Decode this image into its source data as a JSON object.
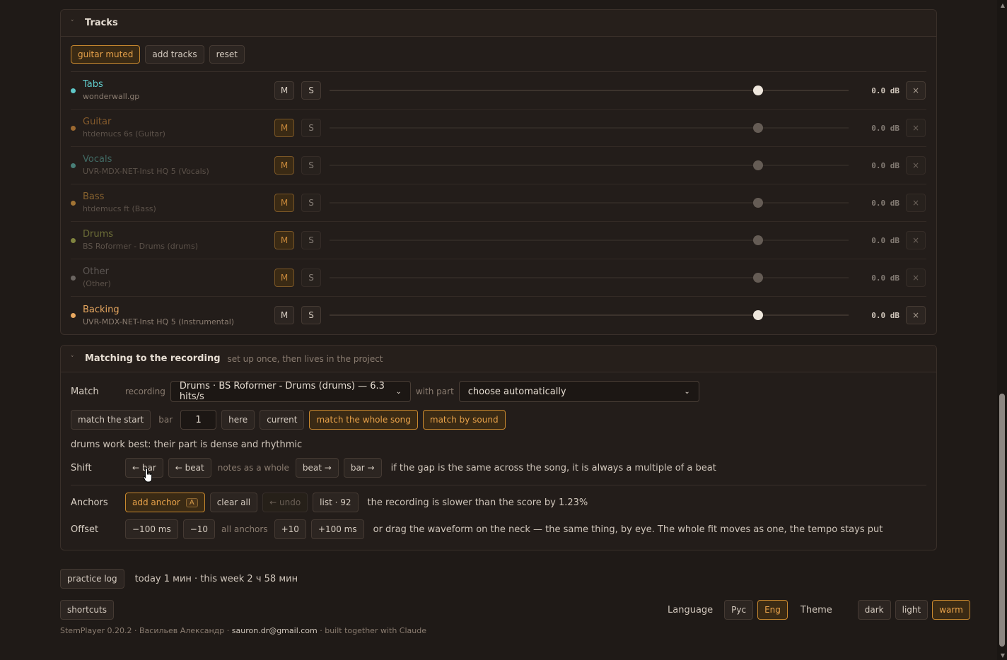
{
  "tracks_panel": {
    "title": "Tracks",
    "buttons": {
      "guitar_muted": "guitar muted",
      "add_tracks": "add tracks",
      "reset": "reset"
    },
    "tracks": [
      {
        "name": "Tabs",
        "source": "wonderwall.gp",
        "color": "#5fc8c8",
        "mute": "M",
        "solo": "S",
        "volume_label": "0.0 dB",
        "level": 0.825,
        "faded": false,
        "muted": false
      },
      {
        "name": "Guitar",
        "source": "htdemucs 6s (Guitar)",
        "color": "#d08a3a",
        "mute": "M",
        "solo": "S",
        "volume_label": "0.0 dB",
        "level": 0.825,
        "faded": true,
        "muted": true
      },
      {
        "name": "Vocals",
        "source": "UVR-MDX-NET-Inst HQ 5 (Vocals)",
        "color": "#58a8a0",
        "mute": "M",
        "solo": "S",
        "volume_label": "0.0 dB",
        "level": 0.825,
        "faded": true,
        "muted": true
      },
      {
        "name": "Bass",
        "source": "htdemucs ft (Bass)",
        "color": "#d89a40",
        "mute": "M",
        "solo": "S",
        "volume_label": "0.0 dB",
        "level": 0.825,
        "faded": true,
        "muted": true
      },
      {
        "name": "Drums",
        "source": "BS Roformer - Drums (drums)",
        "color": "#a8b050",
        "mute": "M",
        "solo": "S",
        "volume_label": "0.0 dB",
        "level": 0.825,
        "faded": true,
        "muted": true
      },
      {
        "name": "Other",
        "source": "(Other)",
        "color": "#8a8480",
        "mute": "M",
        "solo": "S",
        "volume_label": "0.0 dB",
        "level": 0.825,
        "faded": true,
        "muted": true
      },
      {
        "name": "Backing",
        "source": "UVR-MDX-NET-Inst HQ 5 (Instrumental)",
        "color": "#e8a860",
        "mute": "M",
        "solo": "S",
        "volume_label": "0.0 dB",
        "level": 0.825,
        "faded": false,
        "muted": false
      }
    ],
    "remove_glyph": "×"
  },
  "matching_panel": {
    "title": "Matching to the recording",
    "subtitle": "set up once, then lives in the project",
    "match_label": "Match",
    "recording_label": "recording",
    "recording_value": "Drums · BS Roformer - Drums (drums) — 6.3 hits/s",
    "with_part_label": "with part",
    "part_value": "choose automatically",
    "match_start": "match the start",
    "bar_label": "bar",
    "bar_value": "1",
    "here": "here",
    "current": "current",
    "match_whole": "match the whole song",
    "match_sound": "match by sound",
    "hint": "drums work best: their part is dense and rhythmic",
    "shift_label": "Shift",
    "shift_bar_left": "← bar",
    "shift_beat_left": "← beat",
    "shift_mid": "notes as a whole",
    "shift_beat_right": "beat →",
    "shift_bar_right": "bar →",
    "shift_note": "if the gap is the same across the song, it is always a multiple of a beat",
    "anchors_label": "Anchors",
    "add_anchor": "add anchor",
    "add_anchor_key": "A",
    "clear_all": "clear all",
    "undo": "← undo",
    "list": "list · 92",
    "anchors_note": "the recording is slower than the score by 1.23%",
    "offset_label": "Offset",
    "minus100": "−100 ms",
    "minus10": "−10",
    "offset_mid": "all anchors",
    "plus10": "+10",
    "plus100": "+100 ms",
    "offset_note": "or drag the waveform on the neck — the same thing, by eye. The whole fit moves as one, the tempo stays put"
  },
  "practice": {
    "button": "practice log",
    "text": "today 1 мин · this week 2 ч 58 мин"
  },
  "bottom": {
    "shortcuts": "shortcuts",
    "language_label": "Language",
    "lang_ru": "Рус",
    "lang_en": "Eng",
    "theme_label": "Theme",
    "theme_dark": "dark",
    "theme_light": "light",
    "theme_warm": "warm"
  },
  "credits": {
    "prefix": "StemPlayer 0.20.2 · Васильев Александр · ",
    "email": "sauron.dr@gmail.com",
    "suffix": " · built together with Claude"
  }
}
